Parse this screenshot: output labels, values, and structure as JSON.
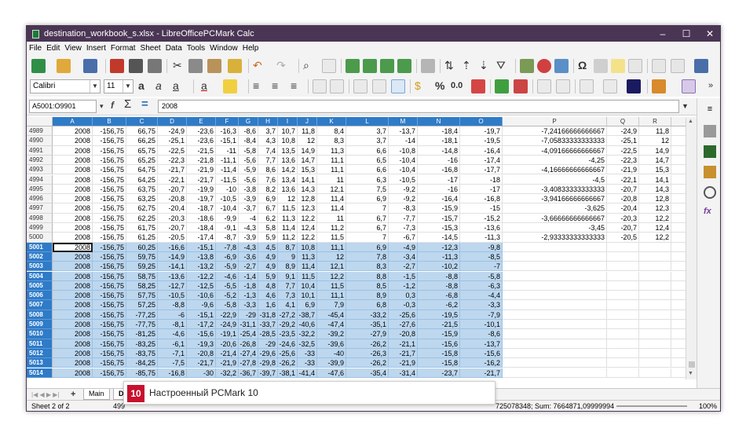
{
  "window": {
    "title": "destination_workbook_s.xlsx - LibreOfficePCMark Calc",
    "controls": [
      "–",
      "☐",
      "✕"
    ]
  },
  "menu": [
    "File",
    "Edit",
    "View",
    "Insert",
    "Format",
    "Sheet",
    "Data",
    "Tools",
    "Window",
    "Help"
  ],
  "format_toolbar": {
    "font_name": "Calibri",
    "font_size": "11"
  },
  "formula_bar": {
    "name_box": "A5001:O9901",
    "input": "2008"
  },
  "columns": [
    "A",
    "B",
    "C",
    "D",
    "E",
    "F",
    "G",
    "H",
    "I",
    "J",
    "K",
    "L",
    "M",
    "N",
    "O",
    "P",
    "Q",
    "R",
    "S"
  ],
  "rows": [
    {
      "n": "4989",
      "c": [
        "2008",
        "-156,75",
        "66,75",
        "-24,9",
        "-23,6",
        "-16,3",
        "-8,6",
        "3,7",
        "10,7",
        "11,8",
        "8,4",
        "3,7",
        "-13,7",
        "-18,4",
        "-19,7",
        "-7,24166666666667",
        "-24,9",
        "11,8",
        ""
      ]
    },
    {
      "n": "4990",
      "c": [
        "2008",
        "-156,75",
        "66,25",
        "-25,1",
        "-23,6",
        "-15,1",
        "-8,4",
        "4,3",
        "10,8",
        "12",
        "8,3",
        "3,7",
        "-14",
        "-18,1",
        "-19,5",
        "-7,05833333333333",
        "-25,1",
        "12",
        ""
      ]
    },
    {
      "n": "4991",
      "c": [
        "2008",
        "-156,75",
        "65,75",
        "-22,5",
        "-21,5",
        "-11",
        "-5,8",
        "7,4",
        "13,5",
        "14,9",
        "11,3",
        "6,6",
        "-10,8",
        "-14,8",
        "-16,4",
        "-4,09166666666667",
        "-22,5",
        "14,9",
        ""
      ]
    },
    {
      "n": "4992",
      "c": [
        "2008",
        "-156,75",
        "65,25",
        "-22,3",
        "-21,8",
        "-11,1",
        "-5,6",
        "7,7",
        "13,6",
        "14,7",
        "11,1",
        "6,5",
        "-10,4",
        "-16",
        "-17,4",
        "-4,25",
        "-22,3",
        "14,7",
        ""
      ]
    },
    {
      "n": "4993",
      "c": [
        "2008",
        "-156,75",
        "64,75",
        "-21,7",
        "-21,9",
        "-11,4",
        "-5,9",
        "8,6",
        "14,2",
        "15,3",
        "11,1",
        "6,6",
        "-10,4",
        "-16,8",
        "-17,7",
        "-4,16666666666667",
        "-21,9",
        "15,3",
        ""
      ]
    },
    {
      "n": "4994",
      "c": [
        "2008",
        "-156,75",
        "64,25",
        "-22,1",
        "-21,7",
        "-11,5",
        "-5,6",
        "7,6",
        "13,4",
        "14,1",
        "11",
        "6,3",
        "-10,5",
        "-17",
        "-18",
        "-4,5",
        "-22,1",
        "14,1",
        ""
      ]
    },
    {
      "n": "4995",
      "c": [
        "2008",
        "-156,75",
        "63,75",
        "-20,7",
        "-19,9",
        "-10",
        "-3,8",
        "8,2",
        "13,6",
        "14,3",
        "12,1",
        "7,5",
        "-9,2",
        "-16",
        "-17",
        "-3,40833333333333",
        "-20,7",
        "14,3",
        ""
      ]
    },
    {
      "n": "4996",
      "c": [
        "2008",
        "-156,75",
        "63,25",
        "-20,8",
        "-19,7",
        "-10,5",
        "-3,9",
        "6,9",
        "12",
        "12,8",
        "11,4",
        "6,9",
        "-9,2",
        "-16,4",
        "-16,8",
        "-3,94166666666667",
        "-20,8",
        "12,8",
        ""
      ]
    },
    {
      "n": "4997",
      "c": [
        "2008",
        "-156,75",
        "62,75",
        "-20,4",
        "-18,7",
        "-10,4",
        "-3,7",
        "6,7",
        "11,5",
        "12,3",
        "11,4",
        "7",
        "-8,3",
        "-15,9",
        "-15",
        "-3,625",
        "-20,4",
        "12,3",
        ""
      ]
    },
    {
      "n": "4998",
      "c": [
        "2008",
        "-156,75",
        "62,25",
        "-20,3",
        "-18,6",
        "-9,9",
        "-4",
        "6,2",
        "11,3",
        "12,2",
        "11",
        "6,7",
        "-7,7",
        "-15,7",
        "-15,2",
        "-3,66666666666667",
        "-20,3",
        "12,2",
        ""
      ]
    },
    {
      "n": "4999",
      "c": [
        "2008",
        "-156,75",
        "61,75",
        "-20,7",
        "-18,4",
        "-9,1",
        "-4,3",
        "5,8",
        "11,4",
        "12,4",
        "11,2",
        "6,7",
        "-7,3",
        "-15,3",
        "-13,6",
        "-3,45",
        "-20,7",
        "12,4",
        ""
      ]
    },
    {
      "n": "5000",
      "c": [
        "2008",
        "-156,75",
        "61,25",
        "-20,5",
        "-17,4",
        "-8,7",
        "-3,9",
        "5,9",
        "11,2",
        "12,2",
        "11,5",
        "7",
        "-6,7",
        "-14,5",
        "-11,3",
        "-2,93333333333333",
        "-20,5",
        "12,2",
        ""
      ]
    },
    {
      "n": "5001",
      "c": [
        "2008",
        "-156,75",
        "60,25",
        "-16,6",
        "-15,1",
        "-7,8",
        "-4,3",
        "4,5",
        "8,7",
        "10,8",
        "11,1",
        "6,9",
        "-4,9",
        "-12,3",
        "-9,8",
        "",
        "",
        "",
        ""
      ]
    },
    {
      "n": "5002",
      "c": [
        "2008",
        "-156,75",
        "59,75",
        "-14,9",
        "-13,8",
        "-6,9",
        "-3,6",
        "4,9",
        "9",
        "11,3",
        "12",
        "7,8",
        "-3,4",
        "-11,3",
        "-8,5",
        "",
        "",
        "",
        ""
      ]
    },
    {
      "n": "5003",
      "c": [
        "2008",
        "-156,75",
        "59,25",
        "-14,1",
        "-13,2",
        "-5,9",
        "-2,7",
        "4,9",
        "8,9",
        "11,4",
        "12,1",
        "8,3",
        "-2,7",
        "-10,2",
        "-7",
        "",
        "",
        "",
        ""
      ]
    },
    {
      "n": "5004",
      "c": [
        "2008",
        "-156,75",
        "58,75",
        "-13,6",
        "-12,2",
        "-4,6",
        "-1,4",
        "5,9",
        "9,1",
        "11,5",
        "12,2",
        "8,8",
        "-1,5",
        "-8,8",
        "-5,8",
        "",
        "",
        "",
        ""
      ]
    },
    {
      "n": "5005",
      "c": [
        "2008",
        "-156,75",
        "58,25",
        "-12,7",
        "-12,5",
        "-5,5",
        "-1,8",
        "4,8",
        "7,7",
        "10,4",
        "11,5",
        "8,5",
        "-1,2",
        "-8,8",
        "-6,3",
        "",
        "",
        "",
        ""
      ]
    },
    {
      "n": "5006",
      "c": [
        "2008",
        "-156,75",
        "57,75",
        "-10,5",
        "-10,6",
        "-5,2",
        "-1,3",
        "4,6",
        "7,3",
        "10,1",
        "11,1",
        "8,9",
        "0,3",
        "-6,8",
        "-4,4",
        "",
        "",
        "",
        ""
      ]
    },
    {
      "n": "5007",
      "c": [
        "2008",
        "-156,75",
        "57,25",
        "-8,8",
        "-9,6",
        "-5,8",
        "-3,3",
        "1,6",
        "4,1",
        "6,9",
        "7,9",
        "6,8",
        "-0,3",
        "-6,2",
        "-3,3",
        "",
        "",
        "",
        ""
      ]
    },
    {
      "n": "5008",
      "c": [
        "2008",
        "-156,75",
        "-77,25",
        "-6",
        "-15,1",
        "-22,9",
        "-29",
        "-31,8",
        "-27,2",
        "-38,7",
        "-45,4",
        "-33,2",
        "-25,6",
        "-19,5",
        "-7,9",
        "",
        "",
        "",
        ""
      ]
    },
    {
      "n": "5009",
      "c": [
        "2008",
        "-156,75",
        "-77,75",
        "-8,1",
        "-17,2",
        "-24,9",
        "-31,1",
        "-33,7",
        "-29,2",
        "-40,6",
        "-47,4",
        "-35,1",
        "-27,6",
        "-21,5",
        "-10,1",
        "",
        "",
        "",
        ""
      ]
    },
    {
      "n": "5010",
      "c": [
        "2008",
        "-156,75",
        "-81,25",
        "-4,6",
        "-15,6",
        "-19,1",
        "-25,4",
        "-28,5",
        "-23,5",
        "-32,2",
        "-39,2",
        "-27,9",
        "-20,8",
        "-15,9",
        "-8,6",
        "",
        "",
        "",
        ""
      ]
    },
    {
      "n": "5011",
      "c": [
        "2008",
        "-156,75",
        "-83,25",
        "-6,1",
        "-19,3",
        "-20,6",
        "-26,8",
        "-29",
        "-24,6",
        "-32,5",
        "-39,6",
        "-26,2",
        "-21,1",
        "-15,6",
        "-13,7",
        "",
        "",
        "",
        ""
      ]
    },
    {
      "n": "5012",
      "c": [
        "2008",
        "-156,75",
        "-83,75",
        "-7,1",
        "-20,8",
        "-21,4",
        "-27,4",
        "-29,6",
        "-25,6",
        "-33",
        "-40",
        "-26,3",
        "-21,7",
        "-15,8",
        "-15,6",
        "",
        "",
        "",
        ""
      ]
    },
    {
      "n": "5013",
      "c": [
        "2008",
        "-156,75",
        "-84,25",
        "-7,5",
        "-21,7",
        "-21,9",
        "-27,8",
        "-29,8",
        "-26,2",
        "-33",
        "-39,9",
        "-26,2",
        "-21,9",
        "-15,8",
        "-16,2",
        "",
        "",
        "",
        ""
      ]
    },
    {
      "n": "5014",
      "c": [
        "2008",
        "-156,75",
        "-85,75",
        "-16,8",
        "-30",
        "-32,2",
        "-36,7",
        "-39,7",
        "-38,1",
        "-41,4",
        "-47,6",
        "-35,4",
        "-31,4",
        "-23,7",
        "-21,7",
        "",
        "",
        "",
        ""
      ]
    }
  ],
  "tabs": {
    "plus": "+",
    "main": "Main",
    "second_partial": "D"
  },
  "status": {
    "sheet": "Sheet 2 of 2",
    "partial_left": "499",
    "sum_text": "725078348; Sum: 7664871,09999994",
    "zoom": "100%"
  },
  "toast": {
    "logo": "10",
    "text": "Настроенный PCMark 10"
  }
}
